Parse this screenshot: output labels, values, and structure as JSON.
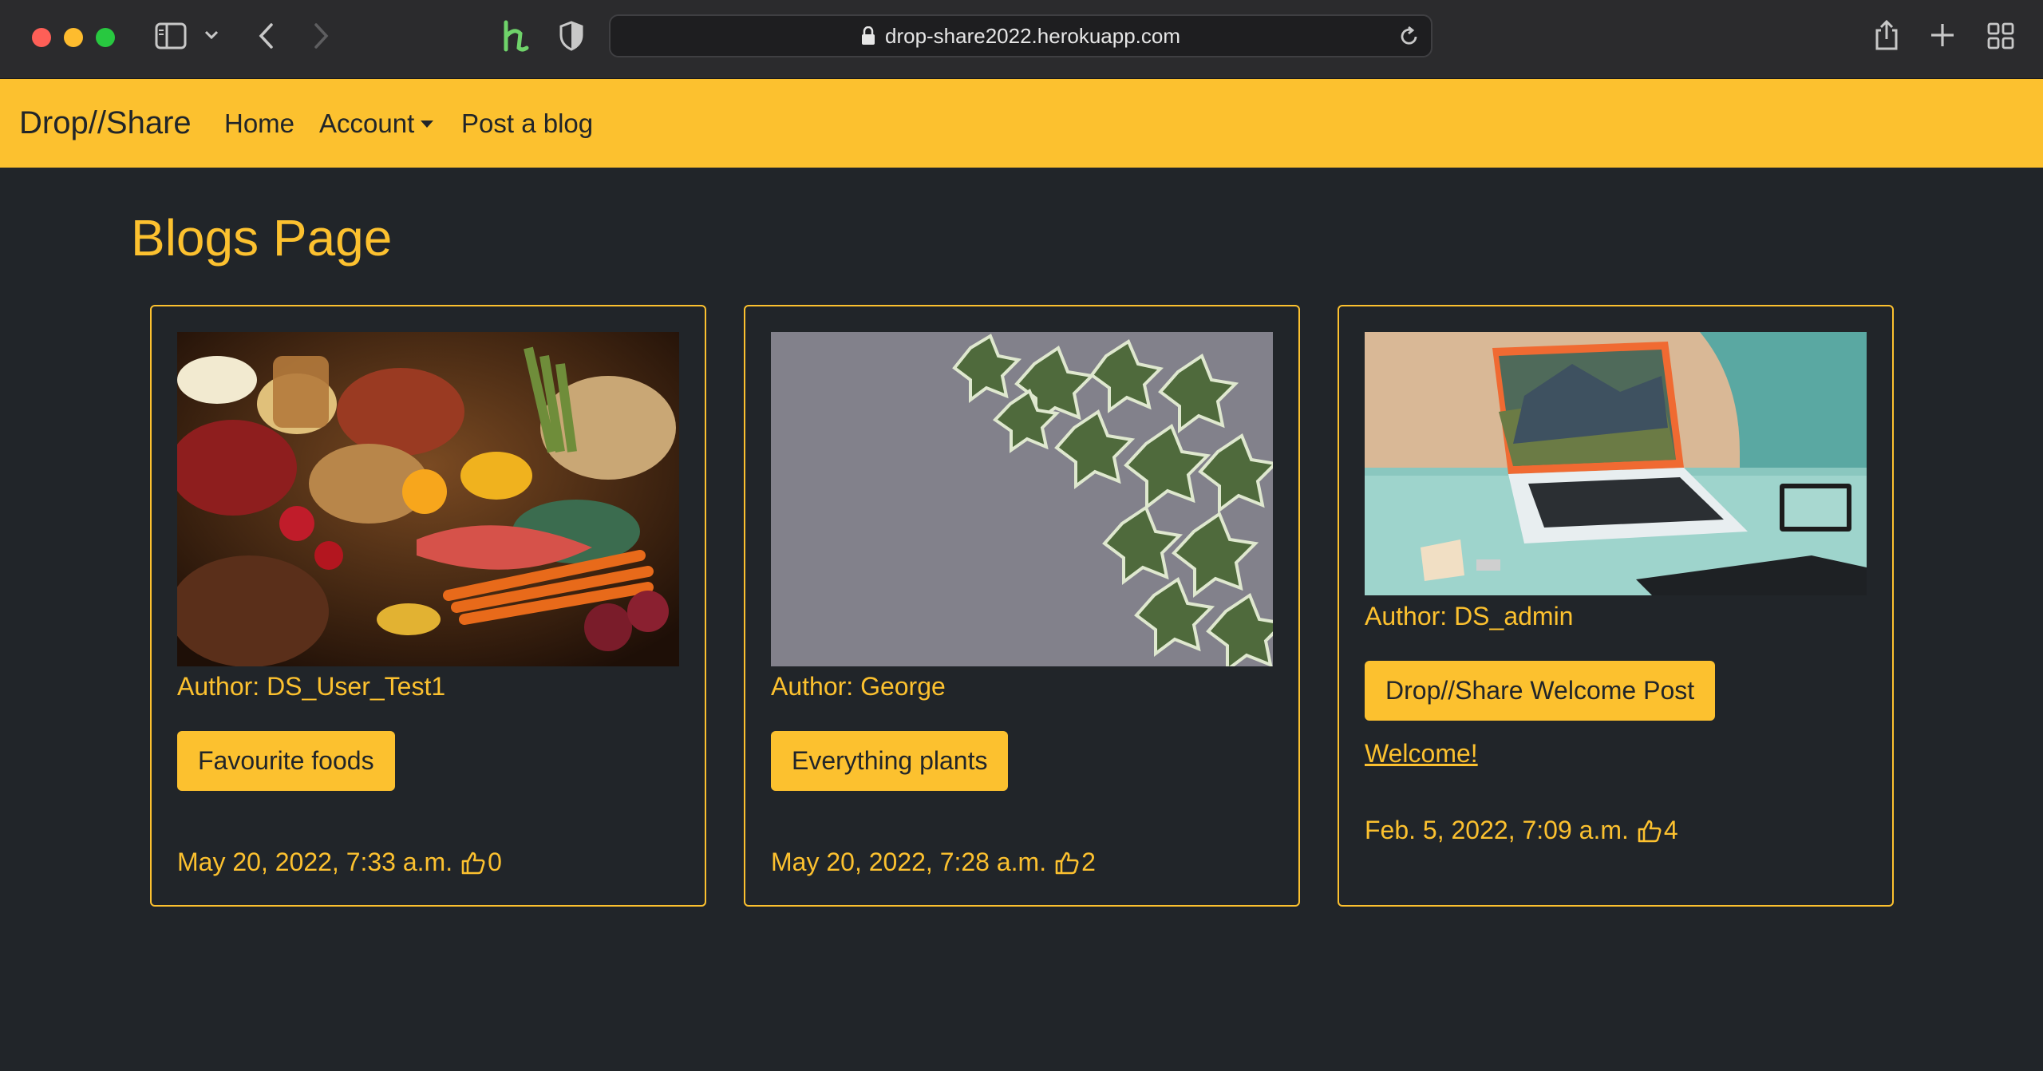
{
  "browser": {
    "url": "drop-share2022.herokuapp.com",
    "icons": [
      "sidebar-icon",
      "chevron-down-icon",
      "back-icon",
      "forward-icon",
      "extension-h-icon",
      "shield-icon",
      "lock-icon",
      "reload-icon",
      "share-icon",
      "new-tab-icon",
      "tab-overview-icon"
    ]
  },
  "navbar": {
    "brand": "Drop//Share",
    "links": {
      "home": "Home",
      "account": "Account",
      "post": "Post a blog"
    }
  },
  "page": {
    "title": "Blogs Page"
  },
  "posts": [
    {
      "author": "Author: DS_User_Test1",
      "title": "Favourite foods",
      "excerpt": "",
      "date": "May 20, 2022, 7:33 a.m.",
      "likes": "0",
      "image": "food-image"
    },
    {
      "author": "Author: George",
      "title": "Everything plants",
      "excerpt": "",
      "date": "May 20, 2022, 7:28 a.m.",
      "likes": "2",
      "image": "ivy-wall-image"
    },
    {
      "author": "Author: DS_admin",
      "title": "Drop//Share Welcome Post",
      "excerpt": "Welcome!",
      "date": "Feb. 5, 2022, 7:09 a.m.",
      "likes": "4",
      "image": "laptop-desk-image"
    }
  ],
  "colors": {
    "accent": "#fcc12f",
    "background": "#212529",
    "chrome": "#2b2b2d"
  }
}
